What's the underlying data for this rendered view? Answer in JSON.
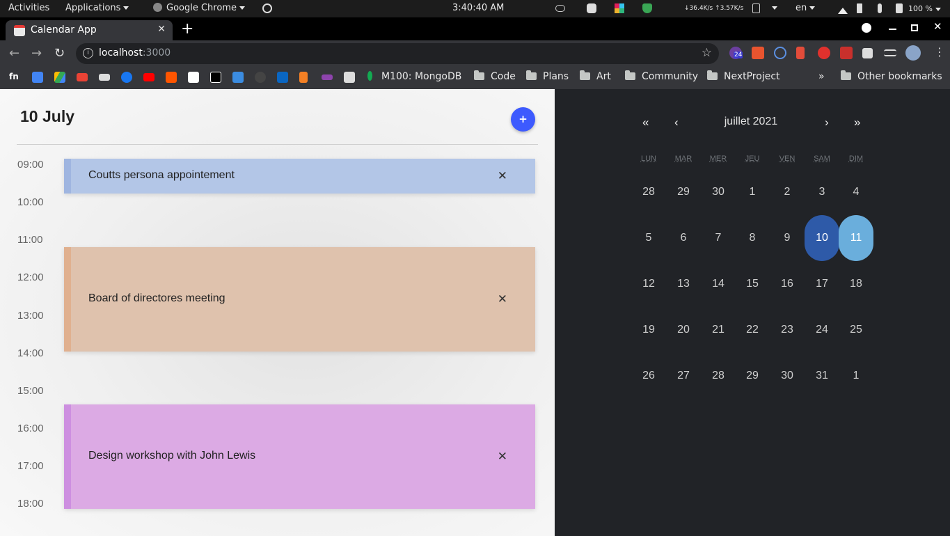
{
  "os_bar": {
    "activities": "Activities",
    "applications": "Applications",
    "chrome_app": "Google Chrome",
    "clock": "3:40:40 AM",
    "net_speed": "↓36.4K/s ↑3.57K/s",
    "language": "en",
    "battery": "100 %"
  },
  "browser": {
    "tab_title": "Calendar App",
    "url_host": "localhost",
    "url_port": ":3000",
    "ext_badge": "24",
    "bookmarks": [
      "M100: MongoDB",
      "Code",
      "Plans",
      "Art",
      "Community",
      "NextProject"
    ],
    "bookmarks_more": "»",
    "other_bookmarks": "Other bookmarks"
  },
  "day_view": {
    "date_title": "10 July",
    "add_label": "+",
    "hours": [
      "09:00",
      "10:00",
      "11:00",
      "12:00",
      "13:00",
      "14:00",
      "15:00",
      "16:00",
      "17:00",
      "18:00"
    ],
    "events": [
      {
        "title": "Coutts persona appointement",
        "close": "✕",
        "color": "#b3c6e7",
        "accent": "#9fb5e0"
      },
      {
        "title": "Board of directores meeting",
        "close": "✕",
        "color": "#dfc2ad",
        "accent": "#e0b08f"
      },
      {
        "title": "Design workshop with John Lewis",
        "close": "✕",
        "color": "#dcaae4",
        "accent": "#cd8fe0"
      }
    ]
  },
  "calendar": {
    "prev_year": "«",
    "prev_month": "‹",
    "month_label": "juillet 2021",
    "next_month": "›",
    "next_year": "»",
    "weekdays": [
      "LUN",
      "MAR",
      "MER",
      "JEU",
      "VEN",
      "SAM",
      "DIM"
    ],
    "weeks": [
      [
        "28",
        "29",
        "30",
        "1",
        "2",
        "3",
        "4"
      ],
      [
        "5",
        "6",
        "7",
        "8",
        "9",
        "10",
        "11"
      ],
      [
        "12",
        "13",
        "14",
        "15",
        "16",
        "17",
        "18"
      ],
      [
        "19",
        "20",
        "21",
        "22",
        "23",
        "24",
        "25"
      ],
      [
        "26",
        "27",
        "28",
        "29",
        "30",
        "31",
        "1"
      ]
    ],
    "selected_color": "#2e5aa8",
    "today_color": "#6aaedc"
  }
}
